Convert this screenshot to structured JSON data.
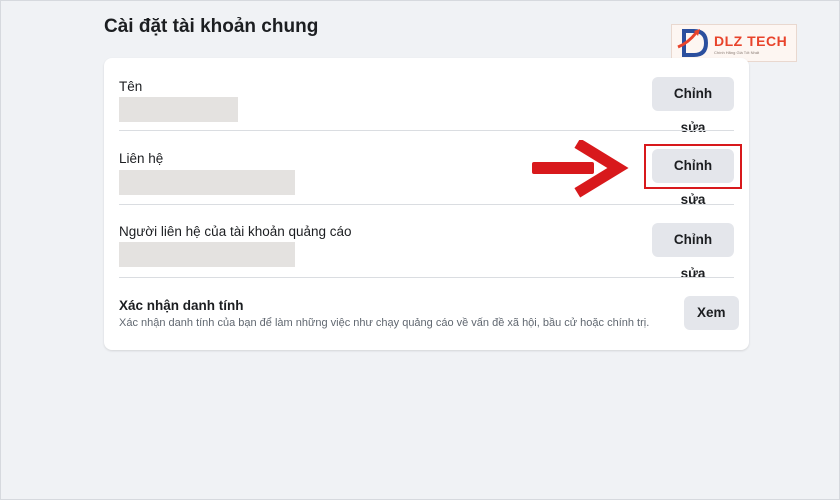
{
  "page": {
    "title": "Cài đặt tài khoản chung"
  },
  "logo": {
    "brand": "DLZ TECH",
    "tagline": "Chính Hãng Giá Tốt Nhất",
    "icon": "dlz-logo-icon"
  },
  "settings": {
    "rows": [
      {
        "label": "Tên",
        "button": "Chỉnh sửa",
        "value_hidden": true
      },
      {
        "label": "Liên hệ",
        "button": "Chỉnh sửa",
        "value_hidden": true
      },
      {
        "label": "Người liên hệ của tài khoản quảng cáo",
        "button": "Chỉnh sửa",
        "value_hidden": true
      },
      {
        "label": "Xác nhận danh tính",
        "description": "Xác nhận danh tính của bạn để làm những việc như chạy quảng cáo về vấn đề xã hội, bầu cử hoặc chính trị.",
        "button": "Xem"
      }
    ]
  },
  "annotation": {
    "arrow_icon": "red-arrow-right-icon",
    "highlight_color": "#d8191c",
    "highlighted_row": "Liên hệ"
  },
  "colors": {
    "background": "#f0f2f5",
    "card": "#ffffff",
    "button": "#e4e6eb",
    "text": "#1c1e21",
    "brand_red": "#e8432b"
  }
}
